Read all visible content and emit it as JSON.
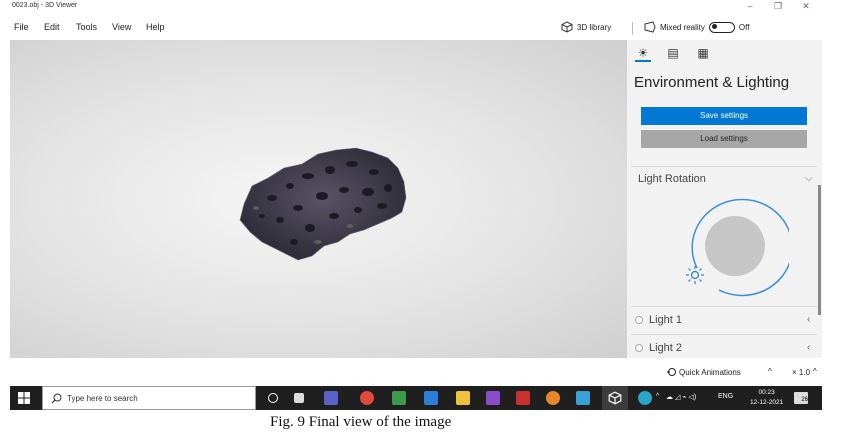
{
  "window": {
    "title": "0023.obj - 3D Viewer",
    "controls": {
      "minimize": "–",
      "maximize": "❐",
      "close": "✕"
    }
  },
  "menu": {
    "items": [
      "File",
      "Edit",
      "Tools",
      "View",
      "Help"
    ],
    "library_label": "3D library",
    "mixed_reality_label": "Mixed reality",
    "mixed_reality_state": "Off"
  },
  "panel": {
    "tabs": [
      {
        "icon": "sun-icon",
        "glyph": "☀"
      },
      {
        "icon": "stats-icon",
        "glyph": "▤"
      },
      {
        "icon": "grid-icon",
        "glyph": "▦"
      }
    ],
    "title": "Environment & Lighting",
    "save_settings": "Save settings",
    "load_settings": "Load settings",
    "light_rotation": "Light Rotation",
    "light1": "Light 1",
    "light2": "Light 2"
  },
  "status": {
    "quick_animations": "Quick Animations",
    "zoom": "× 1.0"
  },
  "taskbar": {
    "search_placeholder": "Type here to search",
    "language": "ENG",
    "time": "00:23",
    "date": "12-12-2021",
    "notifications": "26"
  },
  "caption": "Fig. 9   Final view of  the image",
  "colors": {
    "accent": "#0078d4",
    "taskbar": "#1f1f1f",
    "panel_bg": "#f2f2f2"
  }
}
